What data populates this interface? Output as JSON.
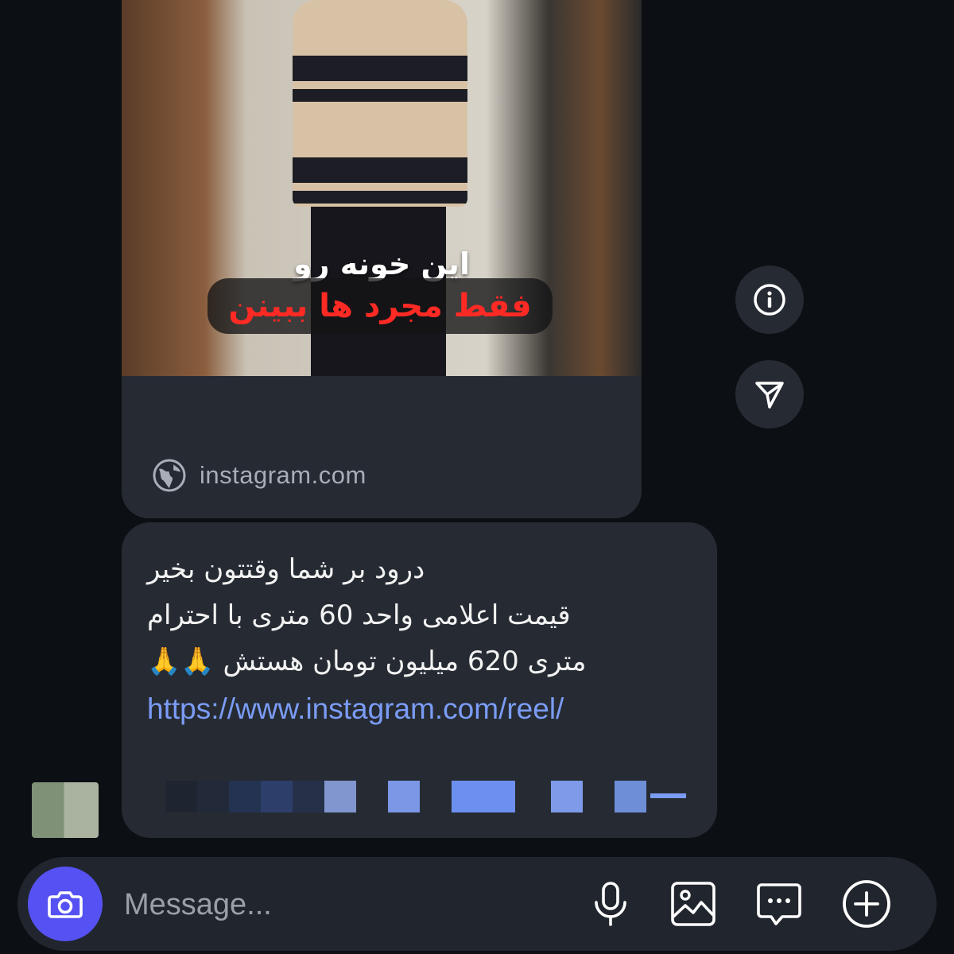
{
  "shared_post": {
    "video": {
      "caption_line1": "این خونه رو",
      "caption_line2": "فقط مجرد ها ببینن"
    },
    "link_domain": "instagram.com",
    "link_icon": "globe-icon"
  },
  "side_actions": [
    {
      "icon": "info-icon"
    },
    {
      "icon": "send-icon"
    }
  ],
  "message": {
    "lines": [
      "درود بر شما وقتتون بخیر",
      "قیمت اعلامی واحد 60 متری با احترام",
      "متری 620 میلیون تومان هستش 🙏🙏"
    ],
    "link": "https://www.instagram.com/reel/"
  },
  "composer": {
    "placeholder": "Message...",
    "camera_icon": "camera-icon",
    "icons": [
      "microphone-icon",
      "gallery-icon",
      "sticker-icon",
      "plus-icon"
    ],
    "accent_color": "#5551f2"
  },
  "colors": {
    "background": "#0c1014",
    "bubble": "#262b33",
    "link": "#7b9cf6"
  }
}
